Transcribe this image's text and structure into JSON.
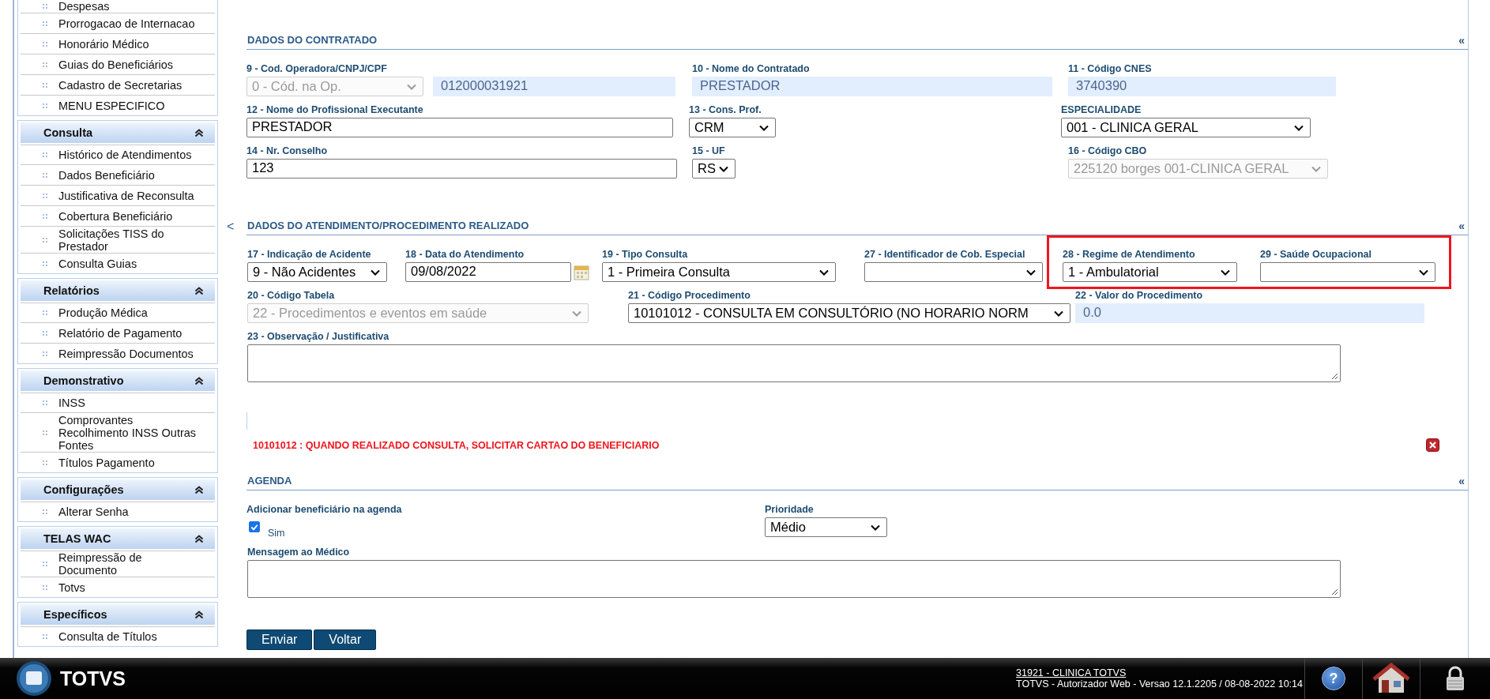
{
  "sidebar": {
    "groups": [
      {
        "items": [
          {
            "label": "Despesas"
          },
          {
            "label": "Prorrogacao de Internacao"
          },
          {
            "label": "Honorário Médico"
          },
          {
            "label": "Guias do Beneficiários"
          },
          {
            "label": "Cadastro de Secretarias"
          },
          {
            "label": "MENU ESPECIFICO"
          }
        ]
      },
      {
        "title": "Consulta",
        "items": [
          {
            "label": "Histórico de Atendimentos"
          },
          {
            "label": "Dados Beneficiário"
          },
          {
            "label": "Justificativa de Reconsulta"
          },
          {
            "label": "Cobertura Beneficiário"
          },
          {
            "label": "Solicitações TISS do Prestador"
          },
          {
            "label": "Consulta Guias"
          }
        ]
      },
      {
        "title": "Relatórios",
        "items": [
          {
            "label": "Produção Médica"
          },
          {
            "label": "Relatório de Pagamento"
          },
          {
            "label": "Reimpressão Documentos"
          }
        ]
      },
      {
        "title": "Demonstrativo",
        "items": [
          {
            "label": "INSS"
          },
          {
            "label": "Comprovantes Recolhimento INSS Outras Fontes"
          },
          {
            "label": "Títulos Pagamento"
          }
        ]
      },
      {
        "title": "Configurações",
        "items": [
          {
            "label": "Alterar Senha"
          }
        ]
      },
      {
        "title": "TELAS WAC",
        "items": [
          {
            "label": "Reimpressão de Documento"
          },
          {
            "label": "Totvs"
          }
        ]
      },
      {
        "title": "Específicos",
        "items": [
          {
            "label": "Consulta de Títulos"
          }
        ]
      }
    ]
  },
  "collapse_arrow": "<",
  "blocks": [
    {
      "kind": "section",
      "title": "DADOS DO CONTRATADO",
      "toggle": "«",
      "fields": [
        {
          "label": "9 - Cod. Operadora/CNPJ/CPF",
          "kind": "select",
          "value": "0 - Cód. na Op.",
          "disabled": true
        },
        {
          "kind": "readonly",
          "value": "012000031921"
        },
        {
          "label": "10 - Nome do Contratado",
          "kind": "readonly",
          "value": "PRESTADOR"
        },
        {
          "label": "11 - Código CNES",
          "kind": "readonly",
          "value": "3740390"
        },
        {
          "label": "12 - Nome do Profissional Executante",
          "kind": "input",
          "value": "PRESTADOR"
        },
        {
          "label": "13 - Cons. Prof.",
          "kind": "select",
          "value": "CRM",
          "disabled": false
        },
        {
          "label": "ESPECIALIDADE",
          "kind": "select",
          "value": "001 - CLINICA GERAL",
          "disabled": false
        },
        {
          "label": "14 - Nr. Conselho",
          "kind": "input",
          "value": "123"
        },
        {
          "label": "15 - UF",
          "kind": "select",
          "value": "RS",
          "disabled": false
        },
        {
          "label": "16 - Código CBO",
          "kind": "select",
          "value": "225120 borges 001-CLINICA GERAL",
          "disabled": true
        }
      ]
    },
    {
      "kind": "section",
      "title": "DADOS DO ATENDIMENTO/PROCEDIMENTO REALIZADO",
      "toggle": "«",
      "fields": [
        {
          "label": "17 - Indicação de Acidente",
          "kind": "select",
          "value": "9 - Não Acidentes",
          "disabled": false,
          "highlighted": false
        },
        {
          "label": "18 - Data do Atendimento",
          "kind": "date",
          "value": "09/08/2022",
          "highlighted": false
        },
        {
          "label": "19 - Tipo Consulta",
          "kind": "select",
          "value": "1 - Primeira Consulta",
          "disabled": false,
          "highlighted": false
        },
        {
          "label": "27 - Identificador de Cob. Especial",
          "kind": "select",
          "disabled": false,
          "highlighted": false
        },
        {
          "label": "28 - Regime de Atendimento",
          "kind": "select",
          "value": "1 - Ambulatorial",
          "disabled": false,
          "highlighted": true
        },
        {
          "label": "29 - Saúde Ocupacional",
          "kind": "select",
          "disabled": false,
          "highlighted": true
        },
        {
          "label": "20 - Código Tabela",
          "kind": "select",
          "value": "22 - Procedimentos e eventos em saúde",
          "disabled": true
        },
        {
          "label": "21 - Código Procedimento",
          "kind": "select",
          "value": "10101012 - CONSULTA EM CONSULTÓRIO (NO HORARIO NORM",
          "disabled": false
        },
        {
          "label": "22 - Valor do Procedimento",
          "kind": "readonly",
          "value": "0.0"
        },
        {
          "label": "23 - Observação / Justificativa",
          "kind": "textarea"
        }
      ]
    },
    {
      "kind": "alert",
      "message": "10101012 : QUANDO REALIZADO CONSULTA, SOLICITAR CARTAO DO BENEFICIARIO"
    },
    {
      "kind": "section",
      "title": "AGENDA",
      "toggle": "«",
      "fields": [
        {
          "label": "Adicionar beneficiário na agenda",
          "kind": "checkbox",
          "checked": true,
          "option": "Sim"
        },
        {
          "label": "Prioridade",
          "kind": "select",
          "value": "Médio",
          "disabled": false
        },
        {
          "label": "Mensagem ao Médico",
          "kind": "textarea"
        }
      ]
    }
  ],
  "buttons": [
    "Enviar",
    "Voltar"
  ],
  "taskbar": {
    "brand": "TOTVS",
    "user": "31921 - CLINICA TOTVS",
    "version": "TOTVS - Autorizador Web - Versao 12.1.2205 / 08-08-2022 10:14",
    "help": "?"
  }
}
